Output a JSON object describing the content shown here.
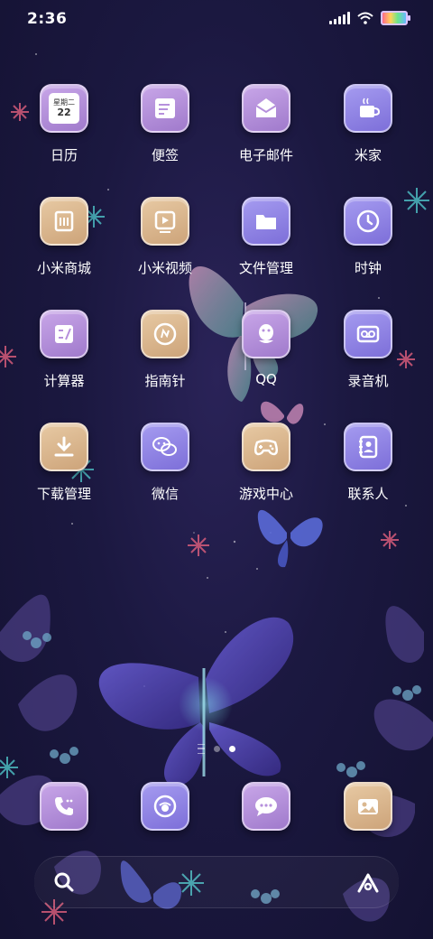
{
  "status": {
    "time": "2:36"
  },
  "apps": [
    {
      "label": "日历",
      "icon": "calendar-icon",
      "style": "purple",
      "cal_weekday": "星期二",
      "cal_day": "22"
    },
    {
      "label": "便签",
      "icon": "notes-icon",
      "style": "purple"
    },
    {
      "label": "电子邮件",
      "icon": "email-icon",
      "style": "purple"
    },
    {
      "label": "米家",
      "icon": "mihome-icon",
      "style": "violet"
    },
    {
      "label": "小米商城",
      "icon": "mi-store-icon",
      "style": "tan"
    },
    {
      "label": "小米视频",
      "icon": "video-icon",
      "style": "tan"
    },
    {
      "label": "文件管理",
      "icon": "folder-icon",
      "style": "violet"
    },
    {
      "label": "时钟",
      "icon": "clock-icon",
      "style": "violet"
    },
    {
      "label": "计算器",
      "icon": "calculator-icon",
      "style": "purple"
    },
    {
      "label": "指南针",
      "icon": "compass-icon",
      "style": "tan"
    },
    {
      "label": "QQ",
      "icon": "qq-icon",
      "style": "purple"
    },
    {
      "label": "录音机",
      "icon": "recorder-icon",
      "style": "violet"
    },
    {
      "label": "下载管理",
      "icon": "download-icon",
      "style": "tan"
    },
    {
      "label": "微信",
      "icon": "wechat-icon",
      "style": "violet"
    },
    {
      "label": "游戏中心",
      "icon": "gamepad-icon",
      "style": "tan"
    },
    {
      "label": "联系人",
      "icon": "contacts-icon",
      "style": "violet"
    }
  ],
  "dock": [
    {
      "icon": "phone-icon",
      "style": "purple"
    },
    {
      "icon": "browser-icon",
      "style": "violet"
    },
    {
      "icon": "messages-icon",
      "style": "purple"
    },
    {
      "icon": "gallery-icon",
      "style": "tan"
    }
  ],
  "pages": {
    "count": 2,
    "active": 1
  },
  "colors": {
    "icon_purple": "#b690dc",
    "icon_tan": "#dab890",
    "icon_violet": "#9186e6",
    "background": "#1b1840"
  }
}
